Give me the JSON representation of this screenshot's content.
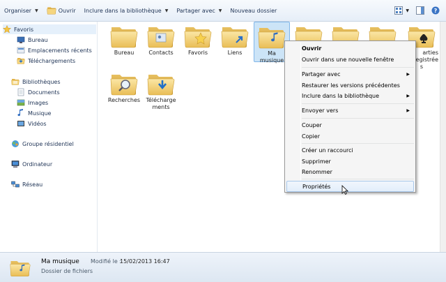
{
  "toolbar": {
    "organize": "Organiser",
    "open": "Ouvrir",
    "include_library": "Inclure dans la bibliothèque",
    "share_with": "Partager avec",
    "new_folder": "Nouveau dossier"
  },
  "sidebar": {
    "favorites": "Favoris",
    "desktop": "Bureau",
    "recent": "Emplacements récents",
    "downloads": "Téléchargements",
    "libraries": "Bibliothèques",
    "documents": "Documents",
    "images": "Images",
    "music": "Musique",
    "videos": "Vidéos",
    "homegroup": "Groupe résidentiel",
    "computer": "Ordinateur",
    "network": "Réseau"
  },
  "folders": {
    "bureau": "Bureau",
    "contacts": "Contacts",
    "favoris": "Favoris",
    "liens": "Liens",
    "ma_musique_1": "Ma",
    "ma_musique_2": "musique",
    "parties_1": "arties",
    "parties_2": "egistrée",
    "parties_3": "s",
    "recherches": "Recherches",
    "telechargements_1": "Télécharge",
    "telechargements_2": "ments"
  },
  "context_menu": {
    "open": "Ouvrir",
    "open_new_window": "Ouvrir dans une nouvelle fenêtre",
    "share_with": "Partager avec",
    "restore_versions": "Restaurer les versions précédentes",
    "include_library": "Inclure dans la bibliothèque",
    "send_to": "Envoyer vers",
    "cut": "Couper",
    "copy": "Copier",
    "create_shortcut": "Créer un raccourci",
    "delete": "Supprimer",
    "rename": "Renommer",
    "properties": "Propriétés"
  },
  "details": {
    "name": "Ma musique",
    "type": "Dossier de fichiers",
    "modified_label": "Modifié le :",
    "modified_value": "15/02/2013 16:47"
  },
  "colors": {
    "folder_yellow": "#f2cf6e",
    "folder_dark": "#d9a93c",
    "selection": "#cce4f7",
    "menu_hover_border": "#a8c8ea"
  }
}
